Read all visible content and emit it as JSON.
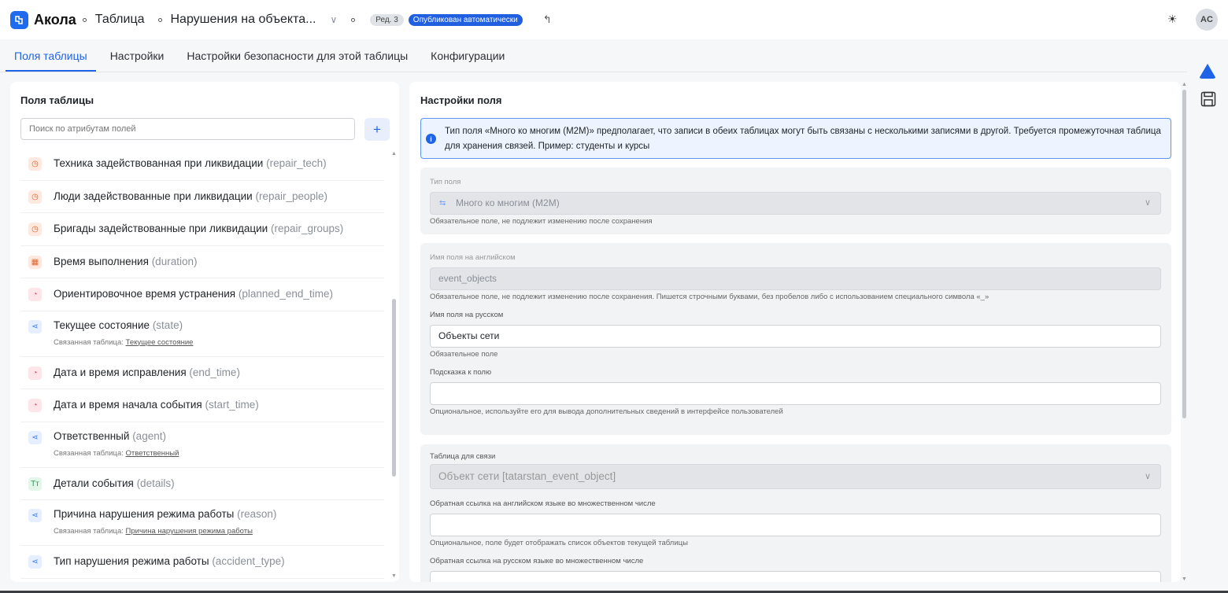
{
  "header": {
    "app_name": "Акола",
    "crumb_table": "Таблица",
    "crumb_name": "Нарушения на объекта...",
    "revision": "Ред. 3",
    "status": "Опубликован автоматически",
    "avatar": "AC"
  },
  "tabs": [
    {
      "label": "Поля таблицы",
      "active": true
    },
    {
      "label": "Настройки",
      "active": false
    },
    {
      "label": "Настройки безопасности для этой таблицы",
      "active": false
    },
    {
      "label": "Конфигурации",
      "active": false
    }
  ],
  "left": {
    "title": "Поля таблицы",
    "search_placeholder": "Поиск по атрибутам полей",
    "add_label": "+",
    "fields": [
      {
        "name": "Техника задействованная при ликвидации",
        "key": "(repair_tech)",
        "icon": "clock-orange",
        "glyph": "◷"
      },
      {
        "name": "Люди задействованные при ликвидации",
        "key": "(repair_people)",
        "icon": "clock-orange",
        "glyph": "◷"
      },
      {
        "name": "Бригады задействованные при ликвидации",
        "key": "(repair_groups)",
        "icon": "clock-orange",
        "glyph": "◷"
      },
      {
        "name": "Время выполнения",
        "key": "(duration)",
        "icon": "calendar-orange",
        "glyph": "▦"
      },
      {
        "name": "Ориентировочное время устранения",
        "key": "(planned_end_time)",
        "icon": "time-pink",
        "glyph": "◔"
      },
      {
        "name": "Текущее состояние",
        "key": "(state)",
        "icon": "link-blue",
        "glyph": "⋖",
        "sub_label": "Связанная таблица:",
        "sub_link": "Текущее состояние"
      },
      {
        "name": "Дата и время исправления",
        "key": "(end_time)",
        "icon": "time-pink",
        "glyph": "◔"
      },
      {
        "name": "Дата и время начала события",
        "key": "(start_time)",
        "icon": "time-pink",
        "glyph": "◔"
      },
      {
        "name": "Ответственный",
        "key": "(agent)",
        "icon": "link-blue",
        "glyph": "⋖",
        "sub_label": "Связанная таблица:",
        "sub_link": "Ответственный"
      },
      {
        "name": "Детали события",
        "key": "(details)",
        "icon": "text-green",
        "glyph": "Tт"
      },
      {
        "name": "Причина нарушения режима работы",
        "key": "(reason)",
        "icon": "link-blue",
        "glyph": "⋖",
        "sub_label": "Связанная таблица:",
        "sub_link": "Причина нарушения режима работы"
      },
      {
        "name": "Тип нарушения режима работы",
        "key": "(accident_type)",
        "icon": "link-blue",
        "glyph": "⋖"
      }
    ]
  },
  "right": {
    "title": "Настройки поля",
    "info": "Тип поля «Много ко многим (M2M)» предполагает, что записи в обеих таблицах могут быть связаны с несколькими записями в другой. Требуется промежуточная таблица для хранения связей. Пример: студенты и курсы",
    "type_label": "Тип поля",
    "type_value": "Много ко многим (M2M)",
    "type_hint": "Обязательное поле, не подлежит изменению после сохранения",
    "en_label": "Имя поля на английском",
    "en_value": "event_objects",
    "en_hint": "Обязательное поле, не подлежит изменению после сохранения. Пишется строчными буквами, без пробелов либо с использованием специального символа «_»",
    "ru_label": "Имя поля на русском",
    "ru_value": "Объекты сети",
    "ru_hint": "Обязательное поле",
    "tip_label": "Подсказка к полю",
    "tip_value": "",
    "tip_hint": "Опциональное, используйте его для вывода дополнительных сведений в интерфейсе пользователей",
    "link_label": "Таблица для связи",
    "link_value": "Объект сети [tatarstan_event_object]",
    "back_en_label": "Обратная ссылка на английском языке во множественном числе",
    "back_en_value": "",
    "back_en_hint": "Опциональное, поле будет отображать список объектов текущей таблицы",
    "back_ru_label": "Обратная ссылка на русском языке во множественном числе"
  }
}
